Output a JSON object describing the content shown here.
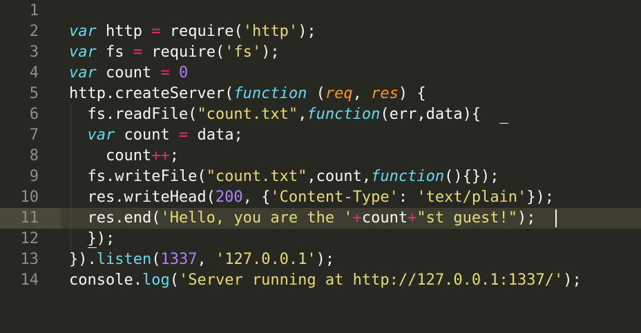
{
  "editor": {
    "theme_colors": {
      "background": "#272822",
      "foreground": "#F8F8F2",
      "keyword": "#66D9EF",
      "operator": "#F92672",
      "string": "#E6DB74",
      "number": "#AE81FF",
      "parameter": "#FD971F",
      "line_number": "#8F908A",
      "active_line": "#3E3D32"
    },
    "active_line": 11,
    "lines": [
      {
        "num": "1",
        "tokens": []
      },
      {
        "num": "2",
        "tokens": [
          {
            "t": "var",
            "c": "k"
          },
          {
            "t": " http "
          },
          {
            "t": "=",
            "c": "o"
          },
          {
            "t": " require("
          },
          {
            "t": "'http'",
            "c": "s"
          },
          {
            "t": ");"
          }
        ]
      },
      {
        "num": "3",
        "tokens": [
          {
            "t": "var",
            "c": "k"
          },
          {
            "t": " fs "
          },
          {
            "t": "=",
            "c": "o"
          },
          {
            "t": " require("
          },
          {
            "t": "'fs'",
            "c": "s"
          },
          {
            "t": ");"
          }
        ]
      },
      {
        "num": "4",
        "tokens": [
          {
            "t": "var",
            "c": "k"
          },
          {
            "t": " count "
          },
          {
            "t": "=",
            "c": "o"
          },
          {
            "t": " "
          },
          {
            "t": "0",
            "c": "n"
          }
        ]
      },
      {
        "num": "5",
        "tokens": [
          {
            "t": "http.createServer("
          },
          {
            "t": "function",
            "c": "k"
          },
          {
            "t": " ("
          },
          {
            "t": "req",
            "c": "p"
          },
          {
            "t": ", "
          },
          {
            "t": "res",
            "c": "p"
          },
          {
            "t": ") {"
          }
        ]
      },
      {
        "num": "6",
        "tokens": [
          {
            "t": "  fs.readFile("
          },
          {
            "t": "\"count.txt\"",
            "c": "s"
          },
          {
            "t": ","
          },
          {
            "t": "function",
            "c": "k"
          },
          {
            "t": "(err,data){"
          }
        ]
      },
      {
        "num": "7",
        "tokens": [
          {
            "t": "  "
          },
          {
            "t": "var",
            "c": "k"
          },
          {
            "t": " count "
          },
          {
            "t": "=",
            "c": "o"
          },
          {
            "t": " data;"
          }
        ]
      },
      {
        "num": "8",
        "tokens": [
          {
            "t": "    count"
          },
          {
            "t": "++",
            "c": "o"
          },
          {
            "t": ";"
          }
        ]
      },
      {
        "num": "9",
        "tokens": [
          {
            "t": "  fs.writeFile("
          },
          {
            "t": "\"count.txt\"",
            "c": "s"
          },
          {
            "t": ",count,"
          },
          {
            "t": "function",
            "c": "k"
          },
          {
            "t": "(){});"
          }
        ]
      },
      {
        "num": "10",
        "tokens": [
          {
            "t": "  res.writeHead("
          },
          {
            "t": "200",
            "c": "n"
          },
          {
            "t": ", {"
          },
          {
            "t": "'Content-Type'",
            "c": "s"
          },
          {
            "t": ": "
          },
          {
            "t": "'text/plain'",
            "c": "s"
          },
          {
            "t": "});"
          }
        ]
      },
      {
        "num": "11",
        "tokens": [
          {
            "t": "  res.end("
          },
          {
            "t": "'Hello, you are the '",
            "c": "s"
          },
          {
            "t": "+",
            "c": "o"
          },
          {
            "t": "count"
          },
          {
            "t": "+",
            "c": "o"
          },
          {
            "t": "\"st guest!\"",
            "c": "s"
          },
          {
            "t": ");"
          }
        ]
      },
      {
        "num": "12",
        "tokens": [
          {
            "t": "  });"
          }
        ]
      },
      {
        "num": "13",
        "tokens": [
          {
            "t": "})."
          },
          {
            "t": "listen",
            "c": "f"
          },
          {
            "t": "("
          },
          {
            "t": "1337",
            "c": "n"
          },
          {
            "t": ", "
          },
          {
            "t": "'127.0.0.1'",
            "c": "s"
          },
          {
            "t": ");"
          }
        ]
      },
      {
        "num": "14",
        "tokens": [
          {
            "t": "console."
          },
          {
            "t": "log",
            "c": "f"
          },
          {
            "t": "("
          },
          {
            "t": "'Server running at http://127.0.0.1:1337/'",
            "c": "s"
          },
          {
            "t": ");"
          }
        ]
      }
    ]
  }
}
